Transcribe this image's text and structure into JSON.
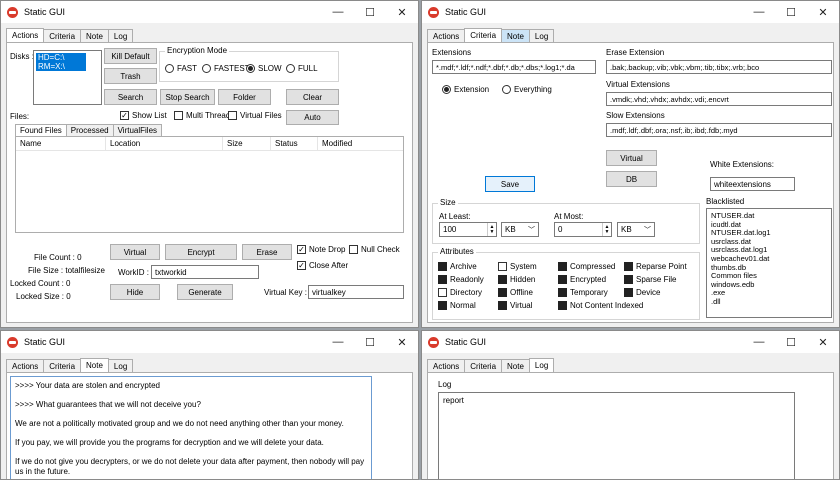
{
  "window_title": "Static GUI",
  "window_controls": {
    "minimize": "—",
    "maximize": "☐",
    "close": "✕"
  },
  "tabs": [
    "Actions",
    "Criteria",
    "Note",
    "Log"
  ],
  "actions": {
    "disks_label": "Disks :",
    "disks": [
      "HD=C:\\",
      "RM=X:\\"
    ],
    "buttons": {
      "kill_default": "Kill Default",
      "trash": "Trash",
      "search": "Search",
      "stop_search": "Stop Search",
      "folder": "Folder",
      "clear": "Clear",
      "auto": "Auto"
    },
    "encryption_mode": {
      "title": "Encryption Mode",
      "options": [
        "FAST",
        "FASTEST",
        "SLOW",
        "FULL"
      ],
      "selected": "SLOW"
    },
    "files_label": "Files:",
    "checks": {
      "show_list": "Show List",
      "multi_thread": "Multi Thread",
      "virtual_files": "Virtual Files"
    },
    "subtabs": [
      "Found Files",
      "Processed",
      "VirtualFiles"
    ],
    "columns": [
      "Name",
      "Location",
      "Size",
      "Status",
      "Modified"
    ],
    "file_count": "File Count :  0",
    "file_size": "File Size :  totalfilesize",
    "locked_count": "Locked Count :  0",
    "locked_size": "Locked Size :  0",
    "bottom_buttons": {
      "virtual": "Virtual",
      "encrypt": "Encrypt",
      "erase": "Erase",
      "hide": "Hide",
      "generate": "Generate"
    },
    "note_drop": "Note Drop",
    "null_check": "Null Check",
    "close_after": "Close After",
    "workid_label": "WorkID :",
    "workid_value": "txtworkid",
    "virtual_key_label": "Virtual Key :",
    "virtual_key_value": "virtualkey"
  },
  "criteria": {
    "extensions_label": "Extensions",
    "extensions_value": "*.mdf;*.ldf;*.ndf;*.dbf;*.db;*.dbs;*.log1;*.da",
    "radio": {
      "extension": "Extension",
      "everything": "Everything"
    },
    "erase_label": "Erase Extension",
    "erase_value": ".bak;.backup;.vib;.vbk;.vbm;.tib;.tibx;.vrb;.bco",
    "virtual_ext_label": "Virtual Extensions",
    "virtual_ext_value": ".vmdk;.vhd;.vhdx;.avhdx;.vdi;.encvrt",
    "slow_ext_label": "Slow Extensions",
    "slow_ext_value": ".mdf;.ldf;.dbf;.ora;.nsf;.ib;.ibd;.fdb;.myd",
    "buttons": {
      "virtual": "Virtual",
      "db": "DB",
      "save": "Save"
    },
    "white_label": "White Extensions:",
    "white_value": "whiteextensions",
    "blacklisted_label": "Blacklisted",
    "blacklisted": [
      "NTUSER.dat",
      "icudtl.dat",
      "NTUSER.dat.log1",
      "usrclass.dat",
      "usrclass.dat.log1",
      "webcachev01.dat",
      "thumbs.db",
      "Common files",
      "windows.edb",
      ".exe",
      ".dll"
    ],
    "size": {
      "title": "Size",
      "at_least_label": "At Least:",
      "at_least_value": "100",
      "at_least_unit": "KB",
      "at_most_label": "At Most:",
      "at_most_value": "0",
      "at_most_unit": "KB"
    },
    "attributes_title": "Attributes",
    "attributes": [
      {
        "label": "Archive",
        "checked": true
      },
      {
        "label": "System",
        "checked": false
      },
      {
        "label": "Compressed",
        "checked": true
      },
      {
        "label": "Reparse Point",
        "checked": true
      },
      {
        "label": "Readonly",
        "checked": true
      },
      {
        "label": "Hidden",
        "checked": true
      },
      {
        "label": "Encrypted",
        "checked": true
      },
      {
        "label": "Sparse File",
        "checked": true
      },
      {
        "label": "Directory",
        "checked": false
      },
      {
        "label": "Offline",
        "checked": true
      },
      {
        "label": "Temporary",
        "checked": true
      },
      {
        "label": "Device",
        "checked": true
      },
      {
        "label": "Normal",
        "checked": true
      },
      {
        "label": "Virtual",
        "checked": true
      },
      {
        "label": "Not Content Indexed",
        "checked": true
      }
    ]
  },
  "note": {
    "lines": [
      ">>>> Your data are stolen and encrypted",
      ">>>> What guarantees that we will not deceive you?",
      "We are not a politically motivated group and we do not need anything other than your money.",
      "If you pay, we will provide you the programs for decryption and we will delete your data.",
      "If we do not give you decrypters, or we do not delete your data after payment, then nobody will pay us in the future."
    ]
  },
  "log": {
    "label": "Log",
    "value": "report"
  }
}
